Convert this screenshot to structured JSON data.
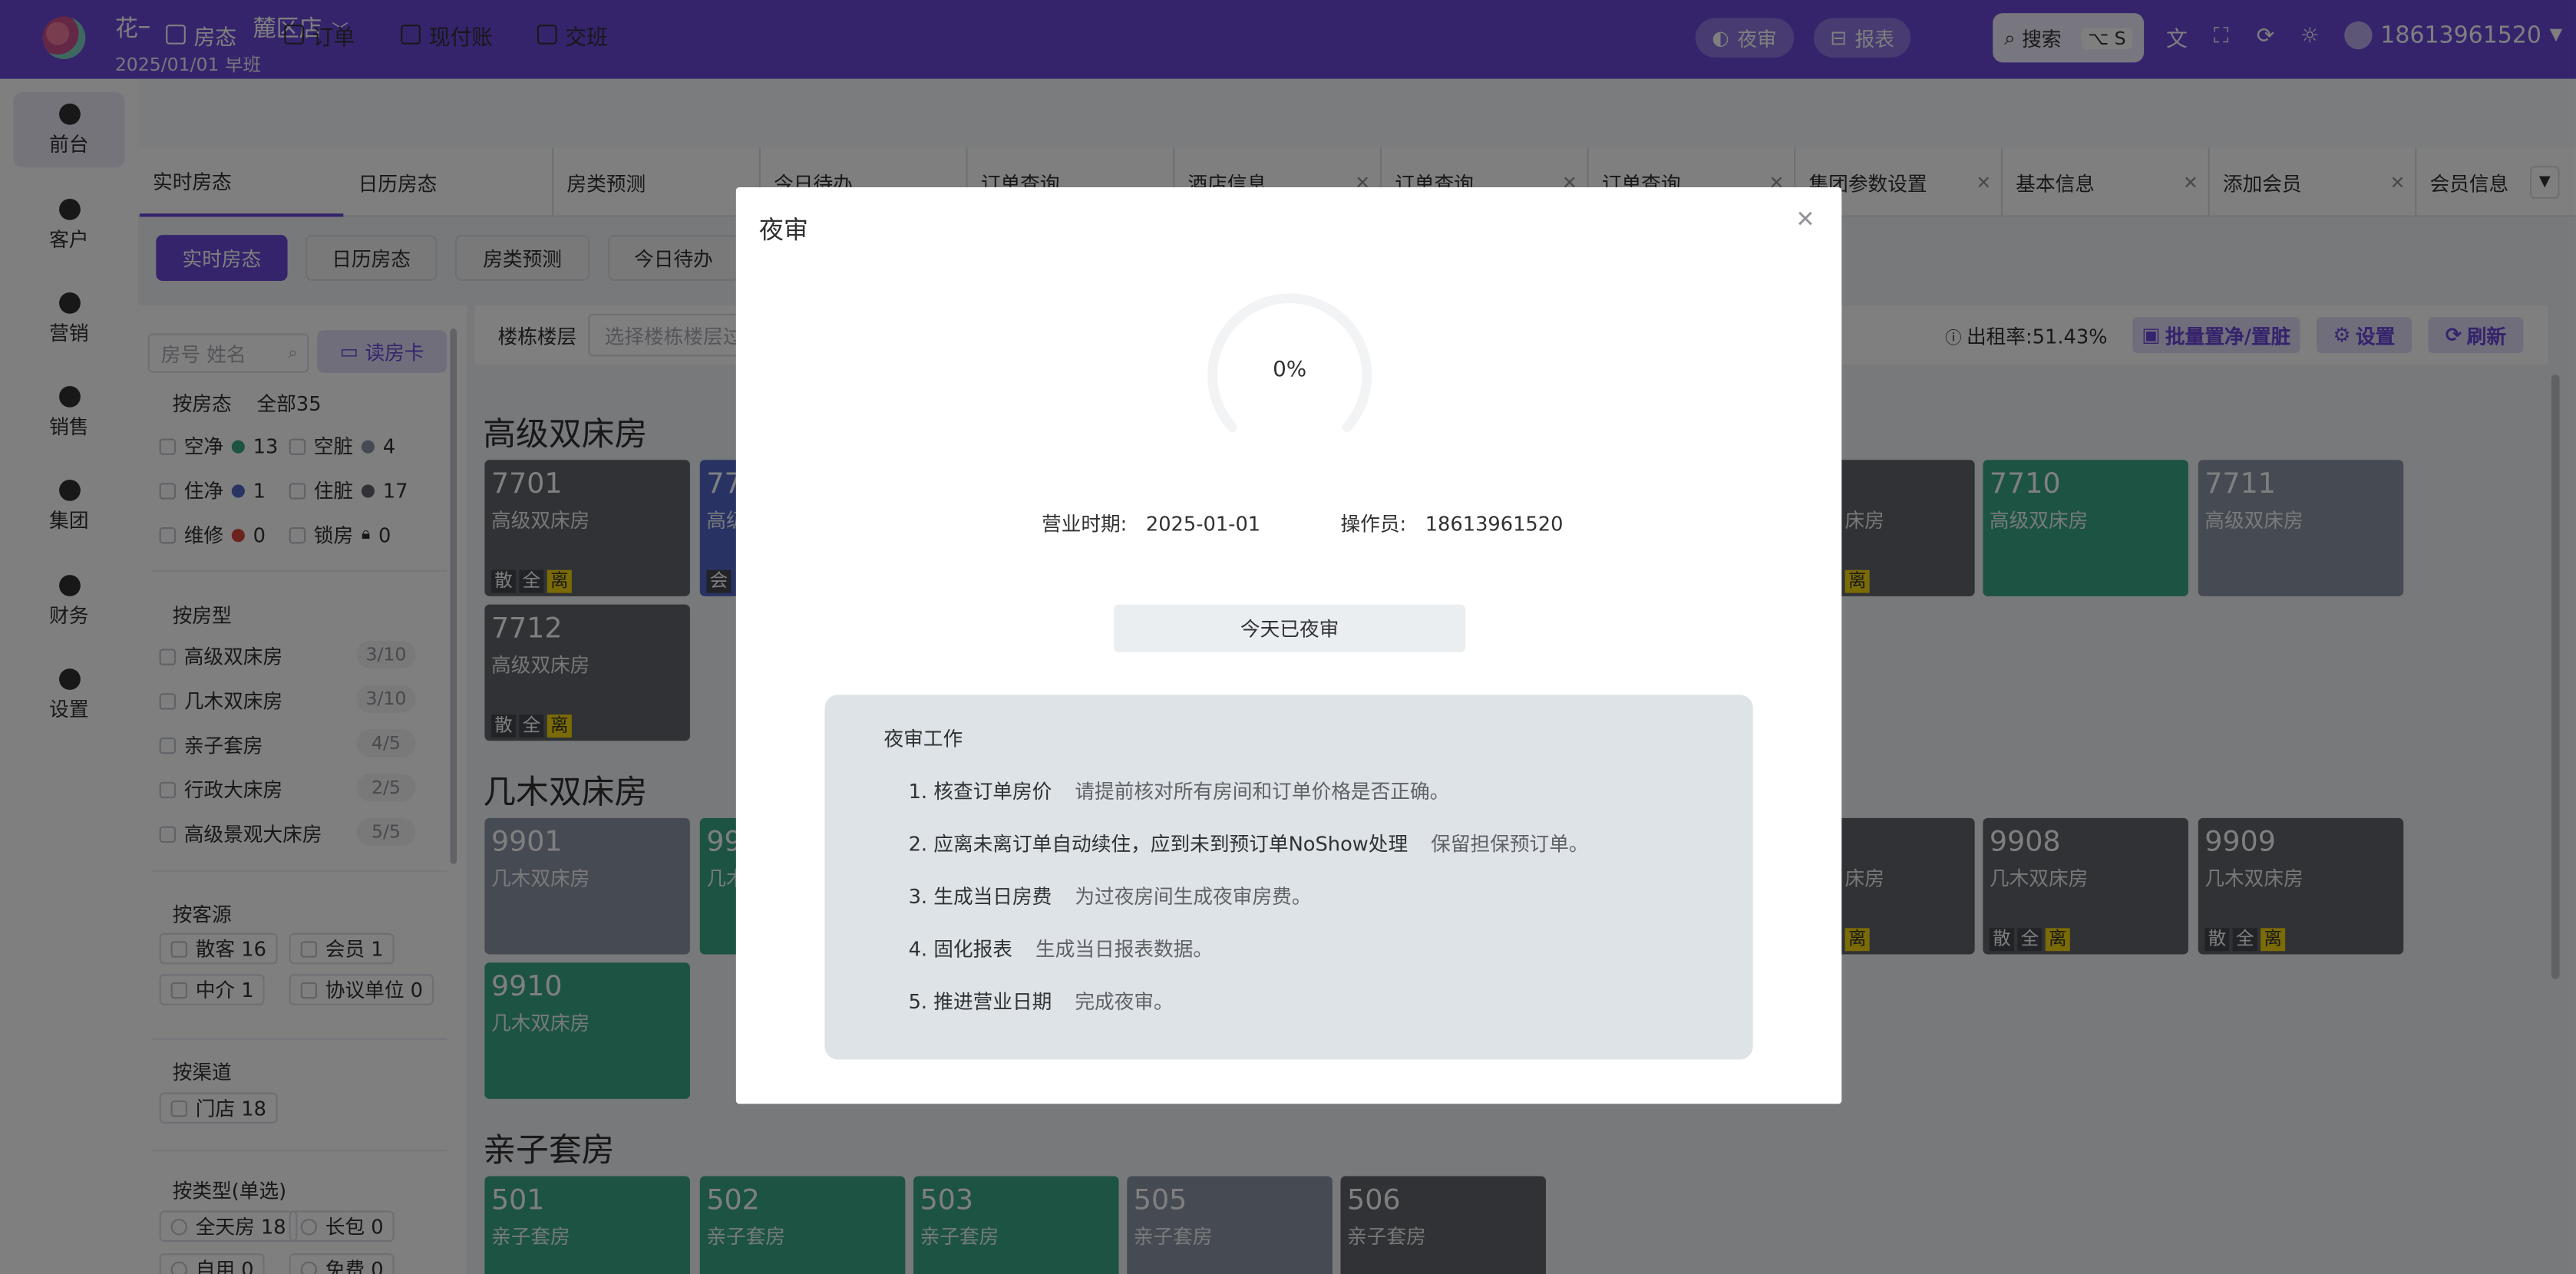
{
  "header": {
    "hotel_name": "花一朵酒店岳麓区店",
    "date_shift": "2025/01/01  早班",
    "night_audit_label": "夜审",
    "report_label": "报表",
    "search_label": "搜索",
    "search_shortcut": "⌥ S",
    "username": "18613961520"
  },
  "sidebar": {
    "items": [
      {
        "label": "前台",
        "icon": "home-icon"
      },
      {
        "label": "客户",
        "icon": "users-icon"
      },
      {
        "label": "营销",
        "icon": "camera-icon"
      },
      {
        "label": "销售",
        "icon": "bag-icon"
      },
      {
        "label": "集团",
        "icon": "globe-icon"
      },
      {
        "label": "财务",
        "icon": "moneybag-icon"
      },
      {
        "label": "设置",
        "icon": "gear-icon"
      }
    ]
  },
  "nav": {
    "items": [
      "房态",
      "订单",
      "现付账",
      "交班"
    ]
  },
  "tabs": [
    {
      "label": "实时房态"
    },
    {
      "label": "日历房态"
    },
    {
      "label": "房类预测"
    },
    {
      "label": "今日待办"
    },
    {
      "label": "订单查询"
    },
    {
      "label": "酒店信息"
    },
    {
      "label": "订单查询"
    },
    {
      "label": "订单查询"
    },
    {
      "label": "集团参数设置"
    },
    {
      "label": "基本信息"
    },
    {
      "label": "添加会员"
    },
    {
      "label": "会员信息"
    }
  ],
  "subtabs": [
    "实时房态",
    "日历房态",
    "房类预测",
    "今日待办"
  ],
  "filters": {
    "search_placeholder": "房号 姓名",
    "read_card": "读房卡",
    "status_title": "按房态",
    "status_total": "全部35",
    "statuses": [
      {
        "label": "空净",
        "count": "13",
        "color": "#3aa687"
      },
      {
        "label": "空脏",
        "count": "4",
        "color": "#8d97a6"
      },
      {
        "label": "住净",
        "count": "1",
        "color": "#5066c9"
      },
      {
        "label": "住脏",
        "count": "17",
        "color": "#61646b"
      },
      {
        "label": "维修",
        "count": "0",
        "color": "#d9443a"
      },
      {
        "label": "锁房",
        "count": "0",
        "color": "#909399"
      }
    ],
    "type_title": "按房型",
    "types": [
      {
        "label": "高级双床房",
        "count": "3/10"
      },
      {
        "label": "几木双床房",
        "count": "3/10"
      },
      {
        "label": "亲子套房",
        "count": "4/5"
      },
      {
        "label": "行政大床房",
        "count": "2/5"
      },
      {
        "label": "高级景观大床房",
        "count": "5/5"
      }
    ],
    "source_title": "按客源",
    "sources": [
      "散客 16",
      "会员 1",
      "中介 1",
      "协议单位 0"
    ],
    "channel_title": "按渠道",
    "channels": [
      "门店 18"
    ],
    "kind_title": "按类型(单选)",
    "kinds": [
      "全天房 18",
      "长包 0",
      "自用 0",
      "免费 0"
    ]
  },
  "toolbar": {
    "floor_label": "楼栋楼层",
    "floor_placeholder": "选择楼栋楼层过滤",
    "occupancy": "出租率:51.43%",
    "batch": "批量置净/置脏",
    "settings": "设置",
    "refresh": "刷新"
  },
  "groups": [
    {
      "title": "高级双床房"
    },
    {
      "title": "几木双床房"
    },
    {
      "title": "亲子套房"
    }
  ],
  "rooms": [
    {
      "num": "7701",
      "type": "高级双床房",
      "tags": [
        "散",
        "全"
      ],
      "tag_y": "离"
    },
    {
      "num": "77",
      "type": "高级",
      "tags": [
        "会"
      ],
      "tag_y": ""
    },
    {
      "num": "",
      "type": "床房",
      "tags": [],
      "tag_y": "离"
    },
    {
      "num": "7710",
      "type": "高级双床房",
      "tags": [],
      "tag_y": ""
    },
    {
      "num": "7711",
      "type": "高级双床房",
      "tags": [],
      "tag_y": ""
    },
    {
      "num": "7712",
      "type": "高级双床房",
      "tags": [
        "散",
        "全"
      ],
      "tag_y": "离"
    },
    {
      "num": "9901",
      "type": "几木双床房",
      "tags": [],
      "tag_y": ""
    },
    {
      "num": "99",
      "type": "几木",
      "tags": [],
      "tag_y": ""
    },
    {
      "num": "",
      "type": "床房",
      "tags": [],
      "tag_y": "离"
    },
    {
      "num": "9908",
      "type": "几木双床房",
      "tags": [
        "散",
        "全"
      ],
      "tag_y": "离"
    },
    {
      "num": "9909",
      "type": "几木双床房",
      "tags": [
        "散",
        "全"
      ],
      "tag_y": "离"
    },
    {
      "num": "9910",
      "type": "几木双床房",
      "tags": [],
      "tag_y": ""
    },
    {
      "num": "501",
      "type": "亲子套房",
      "tags": [],
      "tag_y": ""
    },
    {
      "num": "502",
      "type": "亲子套房",
      "tags": [],
      "tag_y": ""
    },
    {
      "num": "503",
      "type": "亲子套房",
      "tags": [],
      "tag_y": ""
    },
    {
      "num": "505",
      "type": "亲子套房",
      "tags": [],
      "tag_y": ""
    },
    {
      "num": "506",
      "type": "亲子套房",
      "tags": [],
      "tag_y": ""
    }
  ],
  "modal": {
    "title": "夜审",
    "progress": 0,
    "progress_label": "0%",
    "business_date_label": "营业时期:",
    "business_date": "2025-01-01",
    "operator_label": "操作员:",
    "operator": "18613961520",
    "done_button": "今天已夜审",
    "work_title": "夜审工作",
    "steps": [
      {
        "name": "1. 核查订单房价",
        "desc": "请提前核对所有房间和订单价格是否正确。"
      },
      {
        "name": "2. 应离未离订单自动续住，应到未到预订单NoShow处理",
        "desc": "保留担保预订单。"
      },
      {
        "name": "3. 生成当日房费",
        "desc": "为过夜房间生成夜审房费。"
      },
      {
        "name": "4. 固化报表",
        "desc": "生成当日报表数据。"
      },
      {
        "name": "5. 推进营业日期",
        "desc": "完成夜审。"
      }
    ]
  }
}
